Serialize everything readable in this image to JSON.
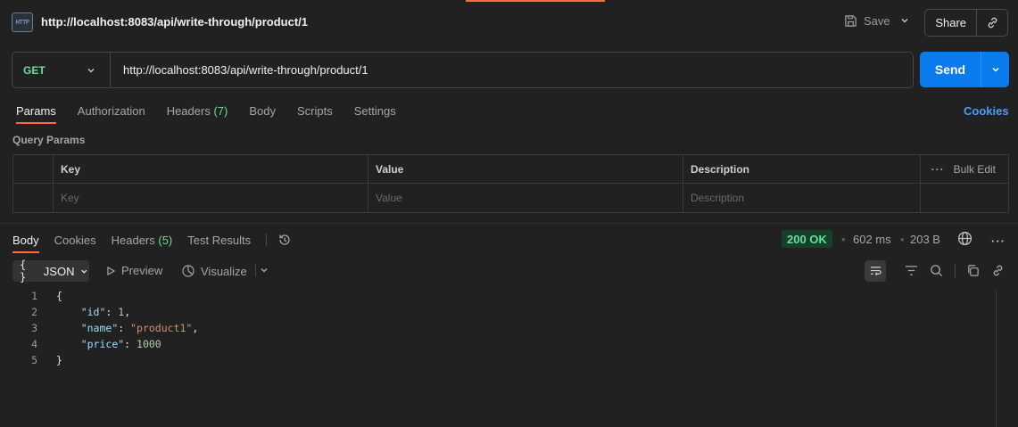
{
  "header": {
    "http_icon_text": "HTTP",
    "request_title": "http://localhost:8083/api/write-through/product/1",
    "save_label": "Save",
    "share_label": "Share"
  },
  "request": {
    "method": "GET",
    "url": "http://localhost:8083/api/write-through/product/1",
    "send_label": "Send"
  },
  "request_tabs": [
    {
      "label": "Params",
      "count": "",
      "active": true
    },
    {
      "label": "Authorization",
      "count": ""
    },
    {
      "label": "Headers",
      "count": "(7)"
    },
    {
      "label": "Body",
      "count": ""
    },
    {
      "label": "Scripts",
      "count": ""
    },
    {
      "label": "Settings",
      "count": ""
    }
  ],
  "cookies_link": "Cookies",
  "query_params": {
    "title": "Query Params",
    "columns": {
      "key": "Key",
      "value": "Value",
      "description": "Description"
    },
    "bulk_edit": "Bulk Edit",
    "placeholders": {
      "key": "Key",
      "value": "Value",
      "description": "Description"
    }
  },
  "response_tabs": [
    {
      "label": "Body",
      "count": "",
      "active": true
    },
    {
      "label": "Cookies",
      "count": ""
    },
    {
      "label": "Headers",
      "count": "(5)"
    },
    {
      "label": "Test Results",
      "count": ""
    }
  ],
  "response_meta": {
    "status": "200 OK",
    "time": "602 ms",
    "size": "203 B"
  },
  "response_toolbar": {
    "format": "JSON",
    "format_icon": "{ }",
    "preview": "Preview",
    "visualize": "Visualize"
  },
  "response_body": {
    "lines": [
      {
        "n": "1"
      },
      {
        "n": "2"
      },
      {
        "n": "3"
      },
      {
        "n": "4"
      },
      {
        "n": "5"
      }
    ],
    "open": "{",
    "close": "}",
    "id_key": "\"id\"",
    "id_value": "1",
    "name_key": "\"name\"",
    "name_value": "\"product1\"",
    "price_key": "\"price\"",
    "price_value": "1000"
  },
  "colors": {
    "accent": "#ff6c37",
    "send": "#097bed",
    "method_get": "#6bdd9a",
    "link": "#4d9cf5",
    "status_ok_bg": "#17402a"
  }
}
